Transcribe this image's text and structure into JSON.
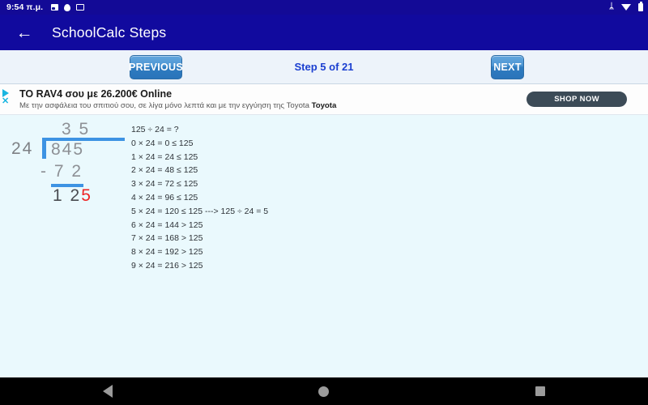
{
  "statusbar": {
    "time": "9:54 π.μ.",
    "icons": [
      "image-icon",
      "location-pin-icon",
      "window-icon"
    ],
    "right_icons": [
      "bluetooth-icon",
      "wifi-icon",
      "battery-icon"
    ],
    "bluetooth_glyph": "ᛦ"
  },
  "appbar": {
    "back_label": "←",
    "title": "SchoolCalc Steps"
  },
  "stepnav": {
    "previous_label": "PREVIOUS",
    "next_label": "NEXT",
    "step_label": "Step 5 of 21"
  },
  "ad": {
    "headline": "TO RAV4 σου με 26.200€ Online",
    "subtext": "Με την ασφάλεια του σπιτιού σου, σε λίγα μόνο λεπτά και με την εγγύηση της Toyota",
    "advertiser": "Toyota",
    "cta_label": "SHOP NOW",
    "close_label": "✕"
  },
  "division": {
    "quotient": "3 5",
    "divisor": "24",
    "dividend": "845",
    "subtrahend": "- 7 2",
    "remainder": "1 2",
    "remainder_highlight": "5",
    "highlight_color": "#ee2222",
    "bracket_color": "#3d93e3"
  },
  "steps_list": [
    "125 ÷ 24 = ?",
    "0 × 24 = 0 ≤ 125",
    "1 × 24 = 24 ≤ 125",
    "2 × 24 = 48 ≤ 125",
    "3 × 24 = 72 ≤ 125",
    "4 × 24 = 96 ≤ 125",
    "5 × 24 = 120 ≤ 125 ---> 125 ÷ 24 = 5",
    "6 × 24 = 144 > 125",
    "7 × 24 = 168 > 125",
    "8 × 24 = 192 > 125",
    "9 × 24 = 216 > 125"
  ],
  "bottomnav": {
    "back": "back-triangle",
    "home": "home-circle",
    "recents": "recents-square"
  }
}
